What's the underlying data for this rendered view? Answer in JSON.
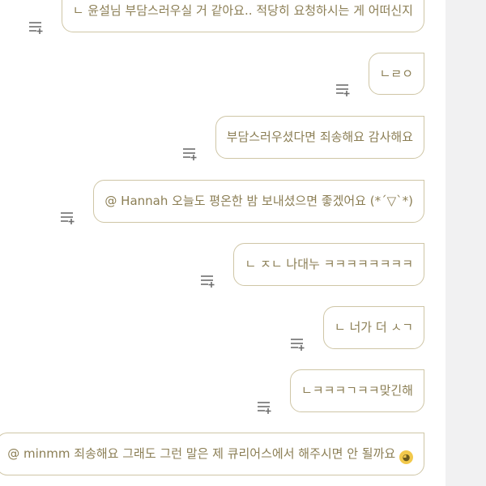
{
  "messages": [
    {
      "text": "ㄴ 윤설님 부담스러우실 거 같아요.. 적당히 요청하시는 게 어떠신지"
    },
    {
      "text": "ㄴㄹㅇ"
    },
    {
      "text": "부담스러우셨다면 죄송해요 감사해요"
    },
    {
      "text": "@ Hannah 오늘도 평온한 밤 보내셨으면 좋겠어요 (*´▽`*)"
    },
    {
      "text": "ㄴ ㅈㄴ 나대누 ㅋㅋㅋㅋㅋㅋㅋㅋ"
    },
    {
      "text": "ㄴ 너가 더 ㅅㄱ"
    },
    {
      "text": "ㄴㅋㅋㅋㄱㅋㅋ맞긴해"
    },
    {
      "text": "@ minmm 죄송해요 그래도 그런 말은 제 큐리어스에서 해주시면 안 될까요",
      "emoji": "pleading-face"
    }
  ],
  "icons": {
    "queue_action": "queue-add-icon"
  },
  "colors": {
    "bubble_border": "#cfc6a6",
    "bubble_text": "#8b7e54",
    "icon": "#6e6e6e",
    "scrollbar_track": "#f1f1f2"
  }
}
